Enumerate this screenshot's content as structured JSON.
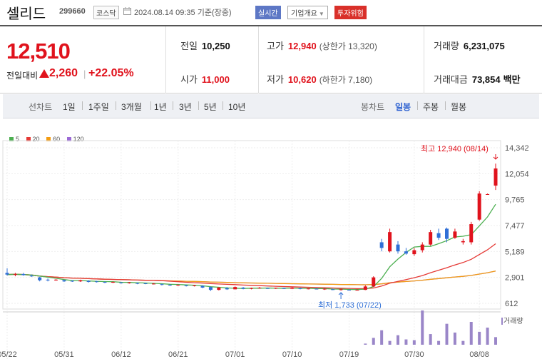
{
  "header": {
    "name": "셀리드",
    "code": "299660",
    "market": "코스닥",
    "as_of": "2024.08.14 09:35 기준(장중)",
    "realtime_label": "실시간",
    "overview_label": "기업개요",
    "risk_label": "투자위험"
  },
  "summary": {
    "price": "12,510",
    "change_label": "전일대비",
    "change": "2,260",
    "change_pct": "+22.05%",
    "prev_close_label": "전일",
    "prev_close": "10,250",
    "open_label": "시가",
    "open": "11,000",
    "high_label": "고가",
    "high": "12,940",
    "upper_limit": "(상한가 13,320)",
    "low_label": "저가",
    "low": "10,620",
    "lower_limit": "(하한가 7,180)",
    "volume_label": "거래량",
    "volume": "6,231,075",
    "amount_label": "거래대금",
    "amount": "73,854",
    "amount_unit": "백만"
  },
  "periods": {
    "line_label": "선차트",
    "line_items": [
      "1일",
      "1주일",
      "3개월",
      "1년",
      "3년",
      "5년",
      "10년"
    ],
    "candle_label": "봉차트",
    "candle_items": [
      "일봉",
      "주봉",
      "월봉"
    ],
    "candle_active": "일봉"
  },
  "colors": {
    "up": "#e0121c",
    "down": "#2f6fd6",
    "ma5": "#4caf50",
    "ma20": "#e53935",
    "ma60": "#f39c12",
    "ma120": "#9c6ad6"
  },
  "chart_data": {
    "type": "candlestick",
    "legend": [
      "5",
      "20",
      "60",
      "120"
    ],
    "y_ticks": [
      "14,342",
      "12,054",
      "9,765",
      "7,477",
      "5,189",
      "2,901",
      "612"
    ],
    "ylim": [
      612,
      14342
    ],
    "x_ticks": [
      "05/22",
      "05/31",
      "06/12",
      "06/21",
      "07/01",
      "07/10",
      "07/19",
      "07/30",
      "08/08"
    ],
    "annotations": {
      "high": "최고 12,940 (08/14)",
      "low": "최저 1,733 (07/22)"
    },
    "volume_label": "거래량",
    "candles": [
      {
        "o": 3300,
        "h": 3700,
        "l": 3050,
        "c": 3150
      },
      {
        "o": 3150,
        "h": 3300,
        "l": 3000,
        "c": 3200
      },
      {
        "o": 3200,
        "h": 3300,
        "l": 3050,
        "c": 3100
      },
      {
        "o": 3050,
        "h": 3150,
        "l": 2950,
        "c": 3000
      },
      {
        "o": 2900,
        "h": 2950,
        "l": 2550,
        "c": 2650
      },
      {
        "o": 2700,
        "h": 2800,
        "l": 2550,
        "c": 2650
      },
      {
        "o": 2650,
        "h": 2750,
        "l": 2600,
        "c": 2700
      },
      {
        "o": 2650,
        "h": 2700,
        "l": 2500,
        "c": 2550
      },
      {
        "o": 2600,
        "h": 2650,
        "l": 2500,
        "c": 2550
      },
      {
        "o": 2550,
        "h": 2700,
        "l": 2500,
        "c": 2650
      },
      {
        "o": 2600,
        "h": 2650,
        "l": 2450,
        "c": 2500
      },
      {
        "o": 2550,
        "h": 2600,
        "l": 2450,
        "c": 2500
      },
      {
        "o": 2500,
        "h": 2550,
        "l": 2400,
        "c": 2450
      },
      {
        "o": 2450,
        "h": 2550,
        "l": 2400,
        "c": 2500
      },
      {
        "o": 2450,
        "h": 2500,
        "l": 2350,
        "c": 2400
      },
      {
        "o": 2400,
        "h": 2500,
        "l": 2350,
        "c": 2450
      },
      {
        "o": 2400,
        "h": 2450,
        "l": 2300,
        "c": 2350
      },
      {
        "o": 2380,
        "h": 2420,
        "l": 2300,
        "c": 2320
      },
      {
        "o": 2320,
        "h": 2400,
        "l": 2280,
        "c": 2350
      },
      {
        "o": 2300,
        "h": 2350,
        "l": 2200,
        "c": 2250
      },
      {
        "o": 2250,
        "h": 2300,
        "l": 2150,
        "c": 2200
      },
      {
        "o": 2200,
        "h": 2280,
        "l": 2150,
        "c": 2250
      },
      {
        "o": 2200,
        "h": 2250,
        "l": 2100,
        "c": 2150
      },
      {
        "o": 2150,
        "h": 2250,
        "l": 2100,
        "c": 2200
      },
      {
        "o": 2150,
        "h": 2200,
        "l": 1950,
        "c": 2000
      },
      {
        "o": 2050,
        "h": 2100,
        "l": 1700,
        "c": 1800
      },
      {
        "o": 1800,
        "h": 2050,
        "l": 1750,
        "c": 2000
      },
      {
        "o": 1950,
        "h": 2050,
        "l": 1800,
        "c": 1850
      },
      {
        "o": 1850,
        "h": 2100,
        "l": 1850,
        "c": 2050
      },
      {
        "o": 2000,
        "h": 2050,
        "l": 1850,
        "c": 1900
      },
      {
        "o": 1900,
        "h": 2000,
        "l": 1850,
        "c": 1950
      },
      {
        "o": 1950,
        "h": 2050,
        "l": 1900,
        "c": 2000
      },
      {
        "o": 1950,
        "h": 2000,
        "l": 1900,
        "c": 1920
      },
      {
        "o": 1920,
        "h": 2000,
        "l": 1880,
        "c": 1980
      },
      {
        "o": 1950,
        "h": 2000,
        "l": 1880,
        "c": 1900
      },
      {
        "o": 1900,
        "h": 2050,
        "l": 1880,
        "c": 2000
      },
      {
        "o": 1950,
        "h": 2000,
        "l": 1850,
        "c": 1880
      },
      {
        "o": 1880,
        "h": 1950,
        "l": 1850,
        "c": 1920
      },
      {
        "o": 1900,
        "h": 1950,
        "l": 1850,
        "c": 1870
      },
      {
        "o": 1850,
        "h": 1950,
        "l": 1800,
        "c": 1900
      },
      {
        "o": 1850,
        "h": 1900,
        "l": 1780,
        "c": 1800
      },
      {
        "o": 1800,
        "h": 1880,
        "l": 1733,
        "c": 1850
      },
      {
        "o": 1800,
        "h": 1850,
        "l": 1750,
        "c": 1780
      },
      {
        "o": 1780,
        "h": 1850,
        "l": 1750,
        "c": 1800
      },
      {
        "o": 1800,
        "h": 2200,
        "l": 1780,
        "c": 2100
      },
      {
        "o": 2100,
        "h": 3000,
        "l": 2050,
        "c": 2900
      },
      {
        "o": 6000,
        "h": 6300,
        "l": 5200,
        "c": 5500
      },
      {
        "o": 5200,
        "h": 7200,
        "l": 5100,
        "c": 6900
      },
      {
        "o": 5800,
        "h": 6100,
        "l": 5000,
        "c": 5200
      },
      {
        "o": 5200,
        "h": 5500,
        "l": 4900,
        "c": 5000
      },
      {
        "o": 4950,
        "h": 5500,
        "l": 4800,
        "c": 5300
      },
      {
        "o": 5300,
        "h": 6000,
        "l": 5100,
        "c": 5800
      },
      {
        "o": 5800,
        "h": 7100,
        "l": 5700,
        "c": 6900
      },
      {
        "o": 6800,
        "h": 7200,
        "l": 6200,
        "c": 6400
      },
      {
        "o": 7200,
        "h": 7300,
        "l": 6000,
        "c": 6300
      },
      {
        "o": 6400,
        "h": 7200,
        "l": 6300,
        "c": 6950
      },
      {
        "o": 6000,
        "h": 6300,
        "l": 5800,
        "c": 6100
      },
      {
        "o": 6000,
        "h": 7800,
        "l": 5800,
        "c": 7600
      },
      {
        "o": 8000,
        "h": 10500,
        "l": 7900,
        "c": 10300
      },
      {
        "o": 10250,
        "h": 10300,
        "l": 10200,
        "c": 10250
      },
      {
        "o": 11000,
        "h": 12940,
        "l": 10620,
        "c": 12510
      }
    ],
    "volume": [
      0,
      0,
      0,
      0,
      0,
      0,
      0,
      0,
      0,
      0,
      0,
      0,
      0,
      0,
      0,
      0,
      0,
      0,
      0,
      0,
      0,
      0,
      0,
      0,
      0,
      0,
      0,
      0,
      0,
      0,
      0,
      0,
      0,
      0,
      0,
      0,
      0,
      0,
      0,
      0,
      0,
      0,
      0,
      0,
      3,
      18,
      38,
      10,
      25,
      14,
      12,
      90,
      28,
      10,
      55,
      32,
      10,
      60,
      34,
      45,
      20
    ]
  }
}
